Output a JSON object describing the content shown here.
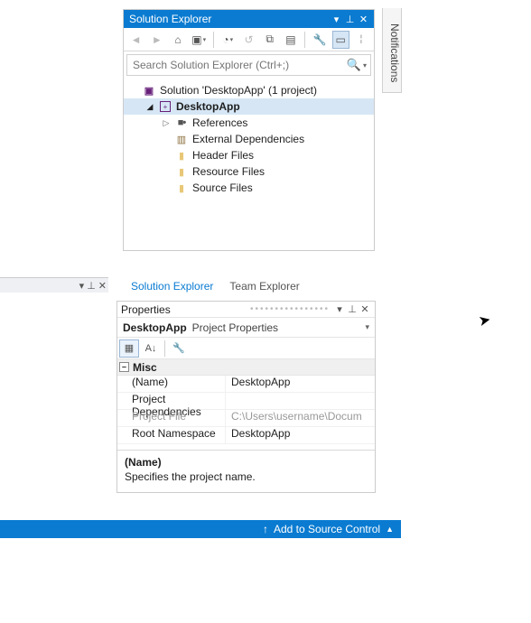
{
  "solutionExplorer": {
    "title": "Solution Explorer",
    "searchPlaceholder": "Search Solution Explorer (Ctrl+;)",
    "solutionLabel": "Solution 'DesktopApp' (1 project)",
    "projectLabel": "DesktopApp",
    "nodes": {
      "references": "References",
      "externalDeps": "External Dependencies",
      "headerFiles": "Header Files",
      "resourceFiles": "Resource Files",
      "sourceFiles": "Source Files"
    },
    "tabs": {
      "solution": "Solution Explorer",
      "team": "Team Explorer"
    }
  },
  "properties": {
    "title": "Properties",
    "objectName": "DesktopApp",
    "objectType": "Project Properties",
    "category": "Misc",
    "rows": {
      "name": {
        "label": "(Name)",
        "value": "DesktopApp"
      },
      "deps": {
        "label": "Project Dependencies",
        "value": ""
      },
      "file": {
        "label": "Project File",
        "value": "C:\\Users\\username\\Docum"
      },
      "ns": {
        "label": "Root Namespace",
        "value": "DesktopApp"
      }
    },
    "help": {
      "title": "(Name)",
      "text": "Specifies the project name."
    }
  },
  "statusBar": {
    "sourceControl": "Add to Source Control"
  },
  "side": {
    "notifications": "Notifications"
  }
}
